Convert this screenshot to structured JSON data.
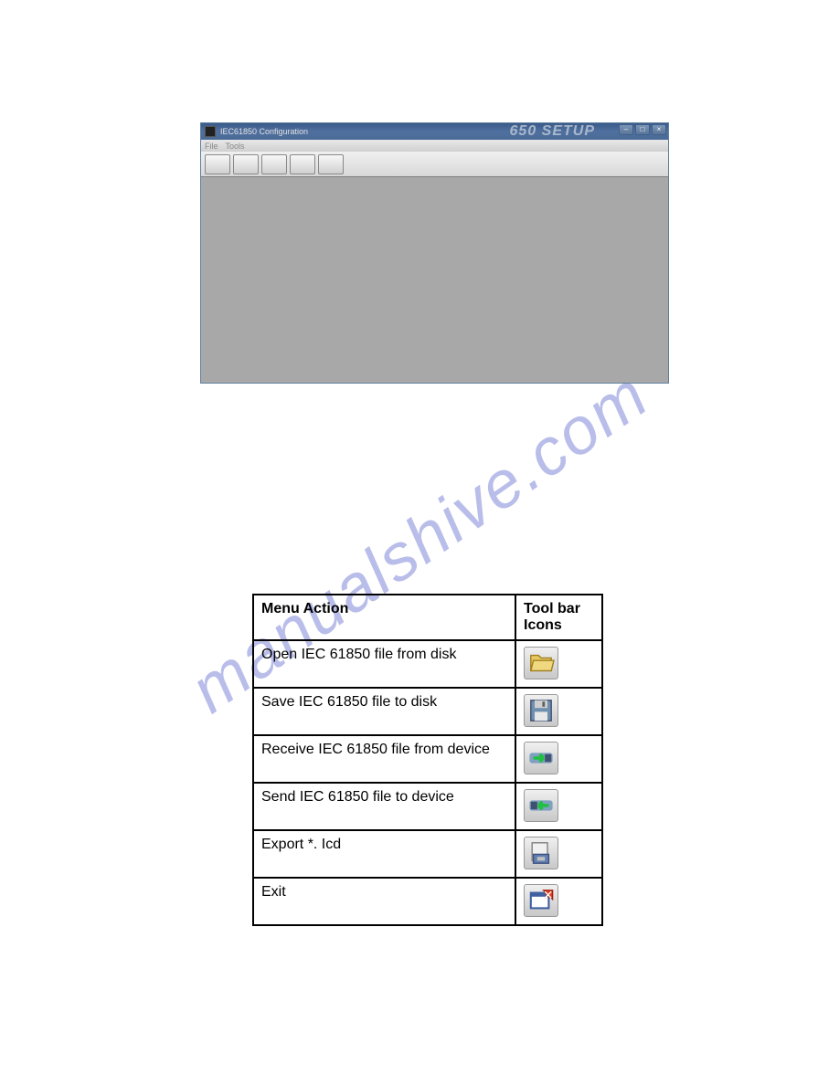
{
  "watermark": "manualshive.com",
  "window": {
    "title": "IEC61850 Configuration",
    "brand": "650 SETUP",
    "menus": [
      "File",
      "Tools"
    ],
    "toolbar_icons": [
      "open-folder-icon",
      "save-icon",
      "receive-icon",
      "send-icon",
      "exit-icon"
    ]
  },
  "table": {
    "headers": {
      "action": "Menu Action",
      "icons": "Tool bar Icons"
    },
    "rows": [
      {
        "action": "Open IEC 61850 file from disk",
        "icon": "open-folder-icon"
      },
      {
        "action": "Save IEC 61850 file to disk",
        "icon": "save-icon"
      },
      {
        "action": "Receive IEC 61850 file from device",
        "icon": "receive-icon"
      },
      {
        "action": "Send IEC 61850 file to device",
        "icon": "send-icon"
      },
      {
        "action": "Export *. Icd",
        "icon": "export-icon"
      },
      {
        "action": "Exit",
        "icon": "exit-icon"
      }
    ]
  }
}
